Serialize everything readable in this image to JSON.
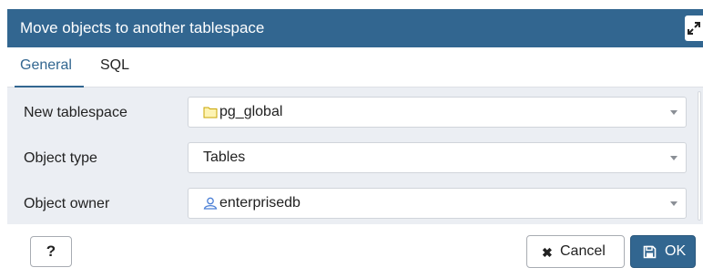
{
  "dialog": {
    "title": "Move objects to another tablespace"
  },
  "tabs": [
    {
      "label": "General",
      "active": true
    },
    {
      "label": "SQL",
      "active": false
    }
  ],
  "form": {
    "new_tablespace": {
      "label": "New tablespace",
      "value": "pg_global",
      "icon": "folder-icon"
    },
    "object_type": {
      "label": "Object type",
      "value": "Tables"
    },
    "object_owner": {
      "label": "Object owner",
      "value": "enterprisedb",
      "icon": "user-icon"
    }
  },
  "footer": {
    "help_label": "?",
    "cancel_label": "Cancel",
    "ok_label": "OK"
  },
  "colors": {
    "accent": "#326690",
    "panel_bg": "#ebeef3"
  }
}
